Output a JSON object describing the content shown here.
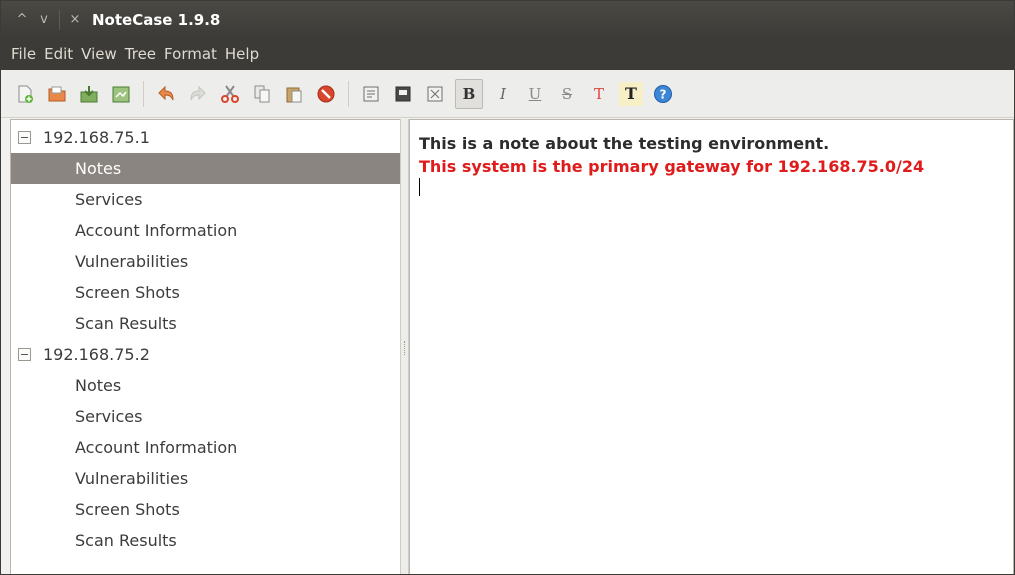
{
  "window": {
    "title": "NoteCase 1.9.8",
    "controls": [
      "^",
      "v",
      "×"
    ]
  },
  "menubar": {
    "items": [
      "File",
      "Edit",
      "View",
      "Tree",
      "Format",
      "Help"
    ]
  },
  "toolbar": {
    "buttons": [
      {
        "name": "new-document",
        "icon": "new-document-icon"
      },
      {
        "name": "open-document",
        "icon": "open-folder-icon"
      },
      {
        "name": "save-document",
        "icon": "save-icon"
      },
      {
        "name": "save-as-document",
        "icon": "save-as-icon"
      },
      {
        "name": "undo",
        "icon": "undo-arrow-icon"
      },
      {
        "name": "redo",
        "icon": "redo-arrow-icon"
      },
      {
        "name": "cut",
        "icon": "scissors-icon"
      },
      {
        "name": "copy",
        "icon": "copy-icon"
      },
      {
        "name": "paste",
        "icon": "paste-icon"
      },
      {
        "name": "delete",
        "icon": "stop-icon"
      },
      {
        "name": "node-insert",
        "icon": "node-insert-icon"
      },
      {
        "name": "node-properties",
        "icon": "node-properties-icon"
      },
      {
        "name": "node-delete",
        "icon": "node-delete-icon"
      },
      {
        "name": "bold",
        "label": "B"
      },
      {
        "name": "italic",
        "label": "I"
      },
      {
        "name": "underline",
        "label": "U"
      },
      {
        "name": "strikethrough",
        "label": "S"
      },
      {
        "name": "text-color",
        "label": "T"
      },
      {
        "name": "background-color",
        "label": "T"
      },
      {
        "name": "help",
        "icon": "help-icon"
      }
    ]
  },
  "tree": {
    "nodes": [
      {
        "label": "192.168.75.1",
        "level": 0
      },
      {
        "label": "Notes",
        "level": 1,
        "selected": true
      },
      {
        "label": "Services",
        "level": 1
      },
      {
        "label": "Account Information",
        "level": 1
      },
      {
        "label": "Vulnerabilities",
        "level": 1
      },
      {
        "label": "Screen Shots",
        "level": 1
      },
      {
        "label": "Scan Results",
        "level": 1
      },
      {
        "label": "192.168.75.2",
        "level": 0
      },
      {
        "label": "Notes",
        "level": 1
      },
      {
        "label": "Services",
        "level": 1
      },
      {
        "label": "Account Information",
        "level": 1
      },
      {
        "label": "Vulnerabilities",
        "level": 1
      },
      {
        "label": "Screen Shots",
        "level": 1
      },
      {
        "label": "Scan Results",
        "level": 1
      }
    ]
  },
  "editor": {
    "lines": [
      {
        "text": "This is a note about the testing environment.",
        "color": "#2d2d2d"
      },
      {
        "text": "This system is the primary gateway for 192.168.75.0/24",
        "color": "#e01b1b"
      }
    ]
  },
  "colors": {
    "titlebar": "#3c3b37",
    "selection": "#8a8580",
    "highlight_text": "#e01b1b"
  }
}
